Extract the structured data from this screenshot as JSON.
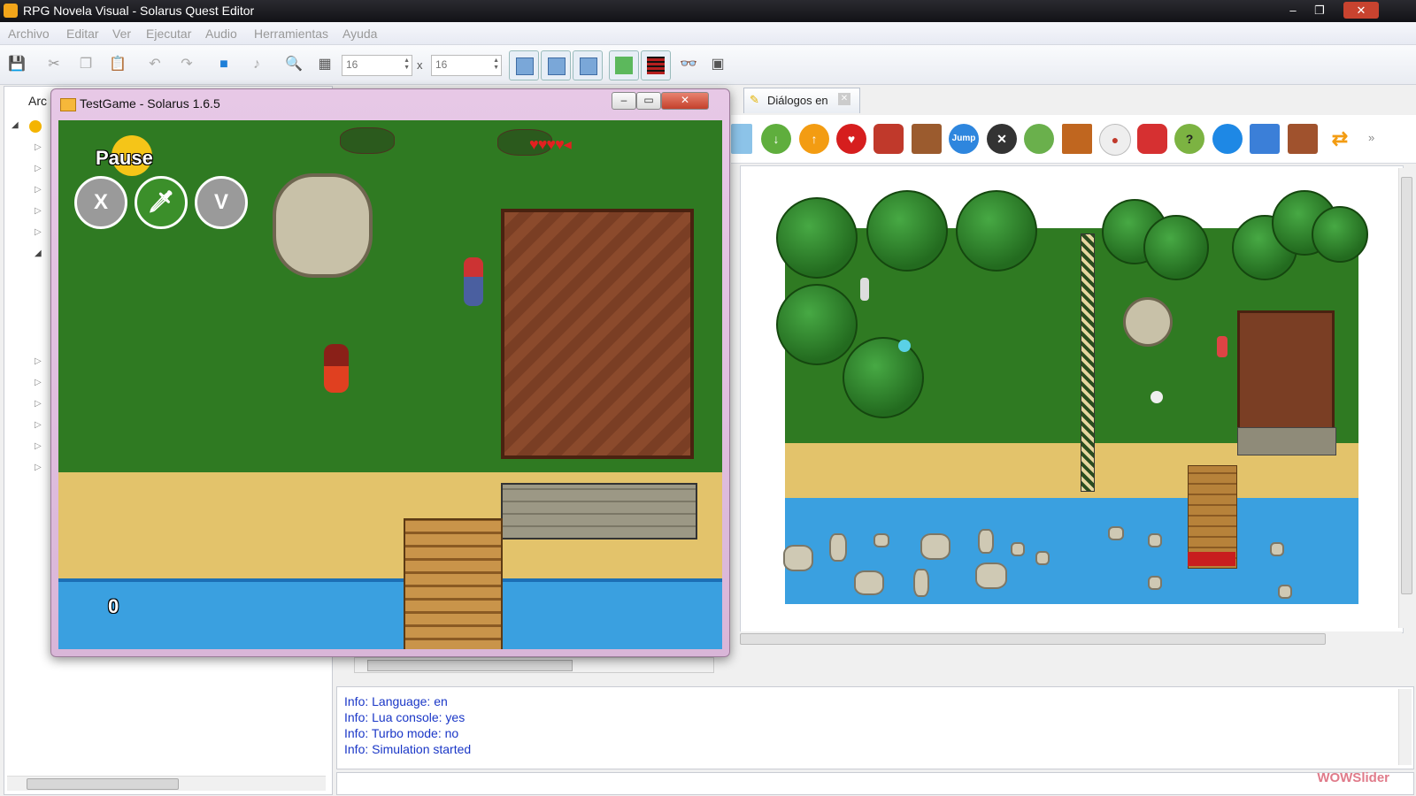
{
  "window": {
    "title": "RPG Novela Visual - Solarus Quest Editor",
    "controls": {
      "minimize": "–",
      "maximize": "❐",
      "close": "✕"
    }
  },
  "menu": [
    "Archivo",
    "Editar",
    "Ver",
    "Ejecutar",
    "Audio",
    "Herramientas",
    "Ayuda"
  ],
  "toolbar": {
    "grid_width": "16",
    "grid_height": "16",
    "times": "x"
  },
  "left_panel": {
    "tab_label": "Arc"
  },
  "tabs": {
    "dialog_tab": "Diálogos en"
  },
  "entities": {
    "jump_label": "Jump",
    "question_label": "?"
  },
  "game_window": {
    "title": "TestGame - Solarus 1.6.5",
    "pause_label": "Pause",
    "x_button": "X",
    "v_button": "V",
    "counter": "0"
  },
  "console": {
    "lines": [
      "Info: Language: en",
      "Info: Lua console: yes",
      "Info: Turbo mode: no",
      "Info: Simulation started"
    ]
  },
  "watermark": "WOWSlider",
  "colors": {
    "grass": "#2f7a22",
    "sand": "#e3c36b",
    "water": "#3aa0e0",
    "roof": "#7a3e24",
    "console_text": "#1a37c7"
  }
}
